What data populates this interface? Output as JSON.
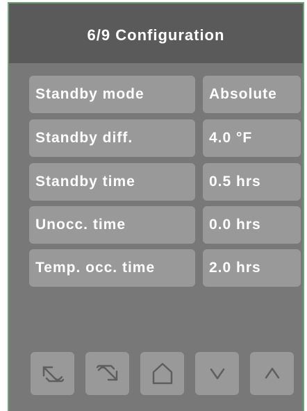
{
  "header": {
    "title": "6/9 Configuration"
  },
  "settings": [
    {
      "label": "Standby mode",
      "value": "Absolute"
    },
    {
      "label": "Standby diff.",
      "value": "4.0 °F"
    },
    {
      "label": "Standby time",
      "value": "0.5 hrs"
    },
    {
      "label": "Unocc. time",
      "value": "0.0 hrs"
    },
    {
      "label": "Temp. occ. time",
      "value": "2.0 hrs"
    }
  ],
  "nav": {
    "icons": [
      "undo-icon",
      "redo-icon",
      "home-icon",
      "chevron-down-icon",
      "chevron-up-icon"
    ]
  },
  "colors": {
    "background": "#787878",
    "header": "#5a5a5a",
    "cell": "#999999",
    "text": "#ffffff",
    "border": "#6aa476",
    "icon": "#5e5e5e"
  }
}
